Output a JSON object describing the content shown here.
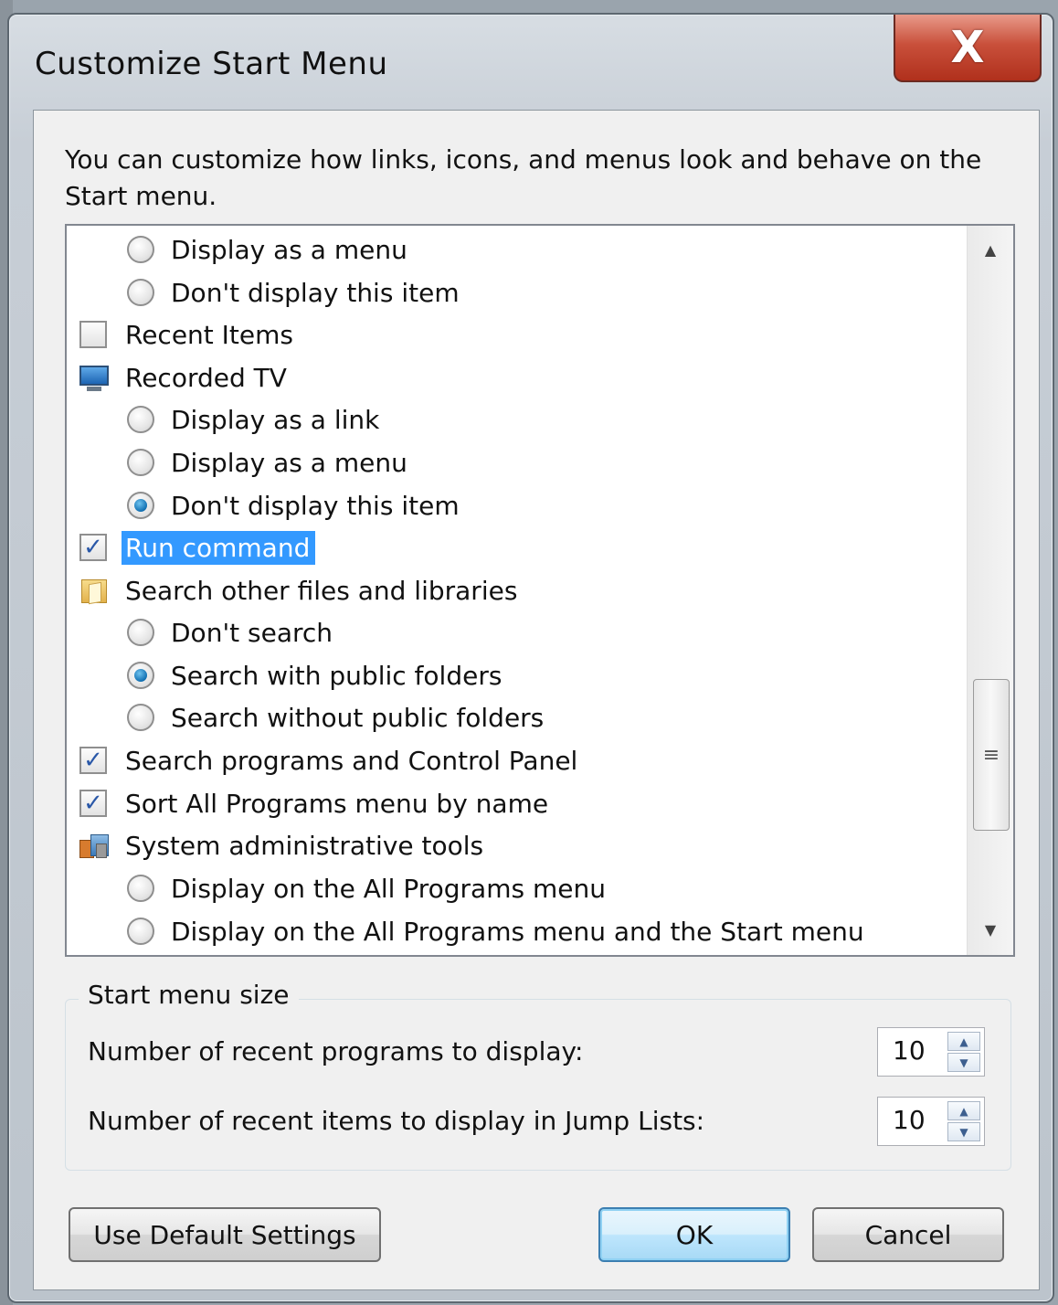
{
  "window": {
    "title": "Customize Start Menu",
    "close_glyph": "X"
  },
  "intro": "You can customize how links, icons, and menus look and behave on the Start menu.",
  "list": {
    "items": [
      {
        "label": "Display as a menu"
      },
      {
        "label": "Don't display this item"
      },
      {
        "label": "Recent Items"
      },
      {
        "label": "Recorded TV"
      },
      {
        "label": "Display as a link"
      },
      {
        "label": "Display as a menu"
      },
      {
        "label": "Don't display this item"
      },
      {
        "label": "Run command"
      },
      {
        "label": "Search other files and libraries"
      },
      {
        "label": "Don't search"
      },
      {
        "label": "Search with public folders"
      },
      {
        "label": "Search without public folders"
      },
      {
        "label": "Search programs and Control Panel"
      },
      {
        "label": "Sort All Programs menu by name"
      },
      {
        "label": "System administrative tools"
      },
      {
        "label": "Display on the All Programs menu"
      },
      {
        "label": "Display on the All Programs menu and the Start menu"
      }
    ],
    "checked_items": [
      "Run command",
      "Search programs and Control Panel",
      "Sort All Programs menu by name"
    ],
    "selected_radios": [
      "Recorded TV: Don't display this item",
      "Search other files and libraries: Search with public folders"
    ],
    "highlighted_item": "Run command"
  },
  "start_menu_size": {
    "legend": "Start menu size",
    "recent_programs_label": "Number of recent programs to display:",
    "recent_programs_value": "10",
    "jump_list_label": "Number of recent items to display in Jump Lists:",
    "jump_list_value": "10"
  },
  "buttons": {
    "use_default": "Use Default Settings",
    "ok": "OK",
    "cancel": "Cancel"
  },
  "colors": {
    "selection": "#3399ff",
    "close_button": "#c9503b",
    "check_mark": "#2a58a8"
  }
}
